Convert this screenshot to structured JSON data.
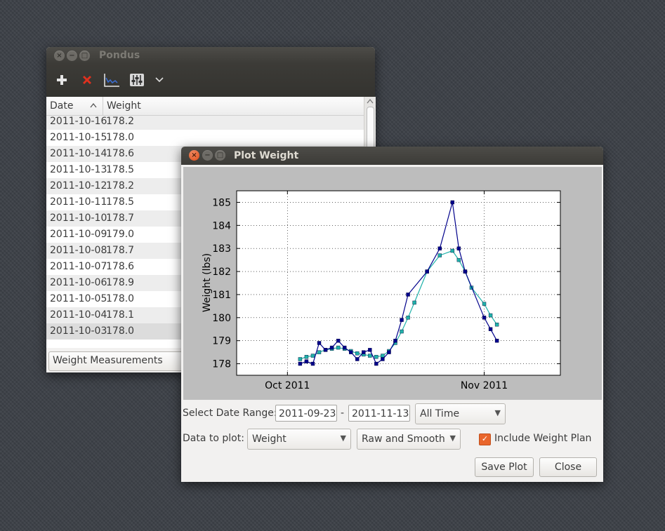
{
  "main_window": {
    "title": "Pondus",
    "table": {
      "headers": [
        "Date",
        "Weight"
      ],
      "rows": [
        {
          "date": "2011-10-16",
          "weight": "178.2"
        },
        {
          "date": "2011-10-15",
          "weight": "178.0"
        },
        {
          "date": "2011-10-14",
          "weight": "178.6"
        },
        {
          "date": "2011-10-13",
          "weight": "178.5"
        },
        {
          "date": "2011-10-12",
          "weight": "178.2"
        },
        {
          "date": "2011-10-11",
          "weight": "178.5"
        },
        {
          "date": "2011-10-10",
          "weight": "178.7"
        },
        {
          "date": "2011-10-09",
          "weight": "179.0"
        },
        {
          "date": "2011-10-08",
          "weight": "178.7"
        },
        {
          "date": "2011-10-07",
          "weight": "178.6"
        },
        {
          "date": "2011-10-06",
          "weight": "178.9"
        },
        {
          "date": "2011-10-05",
          "weight": "178.0"
        },
        {
          "date": "2011-10-04",
          "weight": "178.1"
        },
        {
          "date": "2011-10-03",
          "weight": "178.0"
        }
      ]
    },
    "dataset_select": "Weight Measurements"
  },
  "plot_window": {
    "title": "Plot Weight",
    "date_range_label": "Select Date Range:",
    "date_from": "2011-09-23",
    "date_sep": "-",
    "date_to": "2011-11-13",
    "range_select": "All Time",
    "data_label": "Data to plot:",
    "data_select": "Weight",
    "mode_select": "Raw and Smooth",
    "include_plan_label": "Include Weight Plan",
    "save_label": "Save Plot",
    "close_label": "Close"
  },
  "chart_data": {
    "type": "line",
    "title": "",
    "xlabel": "",
    "ylabel": "Weight (lbs)",
    "xlim": [
      "2011-09-23",
      "2011-11-13"
    ],
    "ylim": [
      177.5,
      185.5
    ],
    "yticks": [
      178,
      179,
      180,
      181,
      182,
      183,
      184,
      185
    ],
    "xticks": [
      {
        "date": "2011-10-01",
        "label": "Oct 2011"
      },
      {
        "date": "2011-11-01",
        "label": "Nov 2011"
      }
    ],
    "grid": true,
    "series": [
      {
        "color": "#00008b",
        "points": [
          [
            "2011-10-03",
            178.0
          ],
          [
            "2011-10-04",
            178.1
          ],
          [
            "2011-10-05",
            178.0
          ],
          [
            "2011-10-06",
            178.9
          ],
          [
            "2011-10-07",
            178.6
          ],
          [
            "2011-10-08",
            178.7
          ],
          [
            "2011-10-09",
            179.0
          ],
          [
            "2011-10-10",
            178.7
          ],
          [
            "2011-10-11",
            178.5
          ],
          [
            "2011-10-12",
            178.2
          ],
          [
            "2011-10-13",
            178.5
          ],
          [
            "2011-10-14",
            178.6
          ],
          [
            "2011-10-15",
            178.0
          ],
          [
            "2011-10-16",
            178.2
          ],
          [
            "2011-10-17",
            178.5
          ],
          [
            "2011-10-18",
            179.0
          ],
          [
            "2011-10-19",
            179.9
          ],
          [
            "2011-10-20",
            181.0
          ],
          [
            "2011-10-23",
            182.0
          ],
          [
            "2011-10-25",
            183.0
          ],
          [
            "2011-10-27",
            185.0
          ],
          [
            "2011-10-28",
            183.0
          ],
          [
            "2011-10-29",
            182.0
          ],
          [
            "2011-11-01",
            180.0
          ],
          [
            "2011-11-02",
            179.5
          ],
          [
            "2011-11-03",
            179.0
          ]
        ]
      },
      {
        "color": "#20b2aa",
        "points": [
          [
            "2011-10-03",
            178.2
          ],
          [
            "2011-10-04",
            178.3
          ],
          [
            "2011-10-05",
            178.35
          ],
          [
            "2011-10-06",
            178.5
          ],
          [
            "2011-10-07",
            178.6
          ],
          [
            "2011-10-08",
            178.65
          ],
          [
            "2011-10-09",
            178.7
          ],
          [
            "2011-10-10",
            178.65
          ],
          [
            "2011-10-11",
            178.55
          ],
          [
            "2011-10-12",
            178.45
          ],
          [
            "2011-10-13",
            178.4
          ],
          [
            "2011-10-14",
            178.35
          ],
          [
            "2011-10-15",
            178.3
          ],
          [
            "2011-10-16",
            178.35
          ],
          [
            "2011-10-17",
            178.55
          ],
          [
            "2011-10-18",
            178.9
          ],
          [
            "2011-10-19",
            179.4
          ],
          [
            "2011-10-20",
            180.0
          ],
          [
            "2011-10-21",
            180.65
          ],
          [
            "2011-10-23",
            182.0
          ],
          [
            "2011-10-25",
            182.7
          ],
          [
            "2011-10-27",
            182.9
          ],
          [
            "2011-10-28",
            182.5
          ],
          [
            "2011-10-29",
            182.0
          ],
          [
            "2011-10-30",
            181.3
          ],
          [
            "2011-11-01",
            180.6
          ],
          [
            "2011-11-02",
            180.1
          ],
          [
            "2011-11-03",
            179.7
          ]
        ]
      }
    ]
  }
}
